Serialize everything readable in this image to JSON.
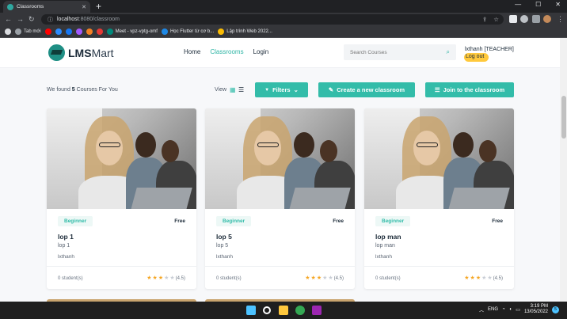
{
  "browser": {
    "tab_title": "Classrooms",
    "tab_close": "✕",
    "new_tab": "+",
    "url_host": "localhost",
    "url_path": ":8080/classroom",
    "back": "←",
    "forward": "→",
    "reload": "↻",
    "info_icon": "ⓘ",
    "win_min": "—",
    "win_max": "☐",
    "win_close": "✕",
    "bookmarks": [
      {
        "label": "Tab mới",
        "color": "#9aa0a6"
      },
      {
        "label": "",
        "color": "#ff0000"
      },
      {
        "label": "",
        "color": "#2d8cff"
      },
      {
        "label": "",
        "color": "#1877f2"
      },
      {
        "label": "",
        "color": "#a259ff"
      },
      {
        "label": "",
        "color": "#f48024"
      },
      {
        "label": "",
        "color": "#e53935"
      },
      {
        "label": "Meet - vpz-vptg-omf",
        "color": "#00897b"
      },
      {
        "label": "Học Flutter từ cơ b...",
        "color": "#1e88e5"
      },
      {
        "label": "Lập trình Web 2022...",
        "color": "#fbbc04"
      }
    ]
  },
  "header": {
    "logo_prefix": "LMS",
    "logo_suffix": "Mart",
    "nav": [
      "Home",
      "Classrooms",
      "Login"
    ],
    "search_placeholder": "Search Courses",
    "search_icon": "⌕",
    "user": "lxthanh [TEACHER]",
    "logout": "Log out"
  },
  "toolbar": {
    "found_prefix": "We found",
    "found_count": "5",
    "found_suffix": "Courses For You",
    "view_label": "View",
    "grid_icon": "▦",
    "list_icon": "☰",
    "filters_label": "Filters",
    "filters_chevron": "⌄",
    "create_label": "Create a new classroom",
    "create_icon": "✎",
    "join_label": "Join to the classroom",
    "join_icon": "☰",
    "filter_icon": "▼"
  },
  "courses": [
    {
      "level": "Beginner",
      "price": "Free",
      "name": "lop 1",
      "desc": "lop 1",
      "teacher": "lxthanh",
      "students": "0 student(s)",
      "rating": 4.5,
      "rating_text": "(4.5)"
    },
    {
      "level": "Beginner",
      "price": "Free",
      "name": "lop 5",
      "desc": "lop 5",
      "teacher": "lxthanh",
      "students": "0 student(s)",
      "rating": 4.5,
      "rating_text": "(4.5)"
    },
    {
      "level": "Beginner",
      "price": "Free",
      "name": "lop man",
      "desc": "lop man",
      "teacher": "lxthanh",
      "students": "0 student(s)",
      "rating": 4.5,
      "rating_text": "(4.5)"
    }
  ],
  "taskbar": {
    "lang": "ENG",
    "time": "3:19 PM",
    "date": "13/05/2022",
    "notif": "5",
    "tray_chevron": "︿",
    "wifi_icon": "◔",
    "volume_icon": "◖",
    "battery_icon": "▭"
  }
}
